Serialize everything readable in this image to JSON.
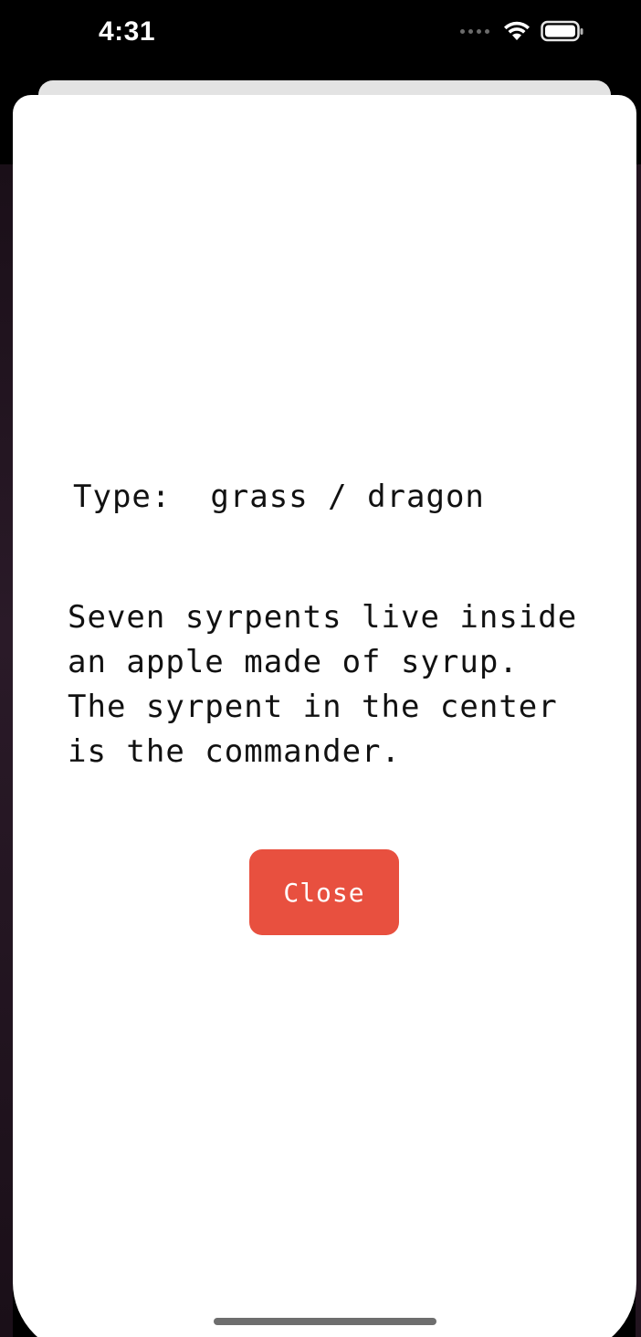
{
  "status_bar": {
    "time": "4:31",
    "icons": [
      "cellular-dots-icon",
      "wifi-icon",
      "battery-icon"
    ]
  },
  "sheet": {
    "type_label": "Type:",
    "type_value": "grass / dragon",
    "description": "Seven syrpents live inside an apple made of syrup. The syrpent in the center is the commander.",
    "close_label": "Close"
  },
  "colors": {
    "close_button": "#e8503f",
    "sheet_background": "#ffffff",
    "back_card": "#e3e3e3"
  }
}
